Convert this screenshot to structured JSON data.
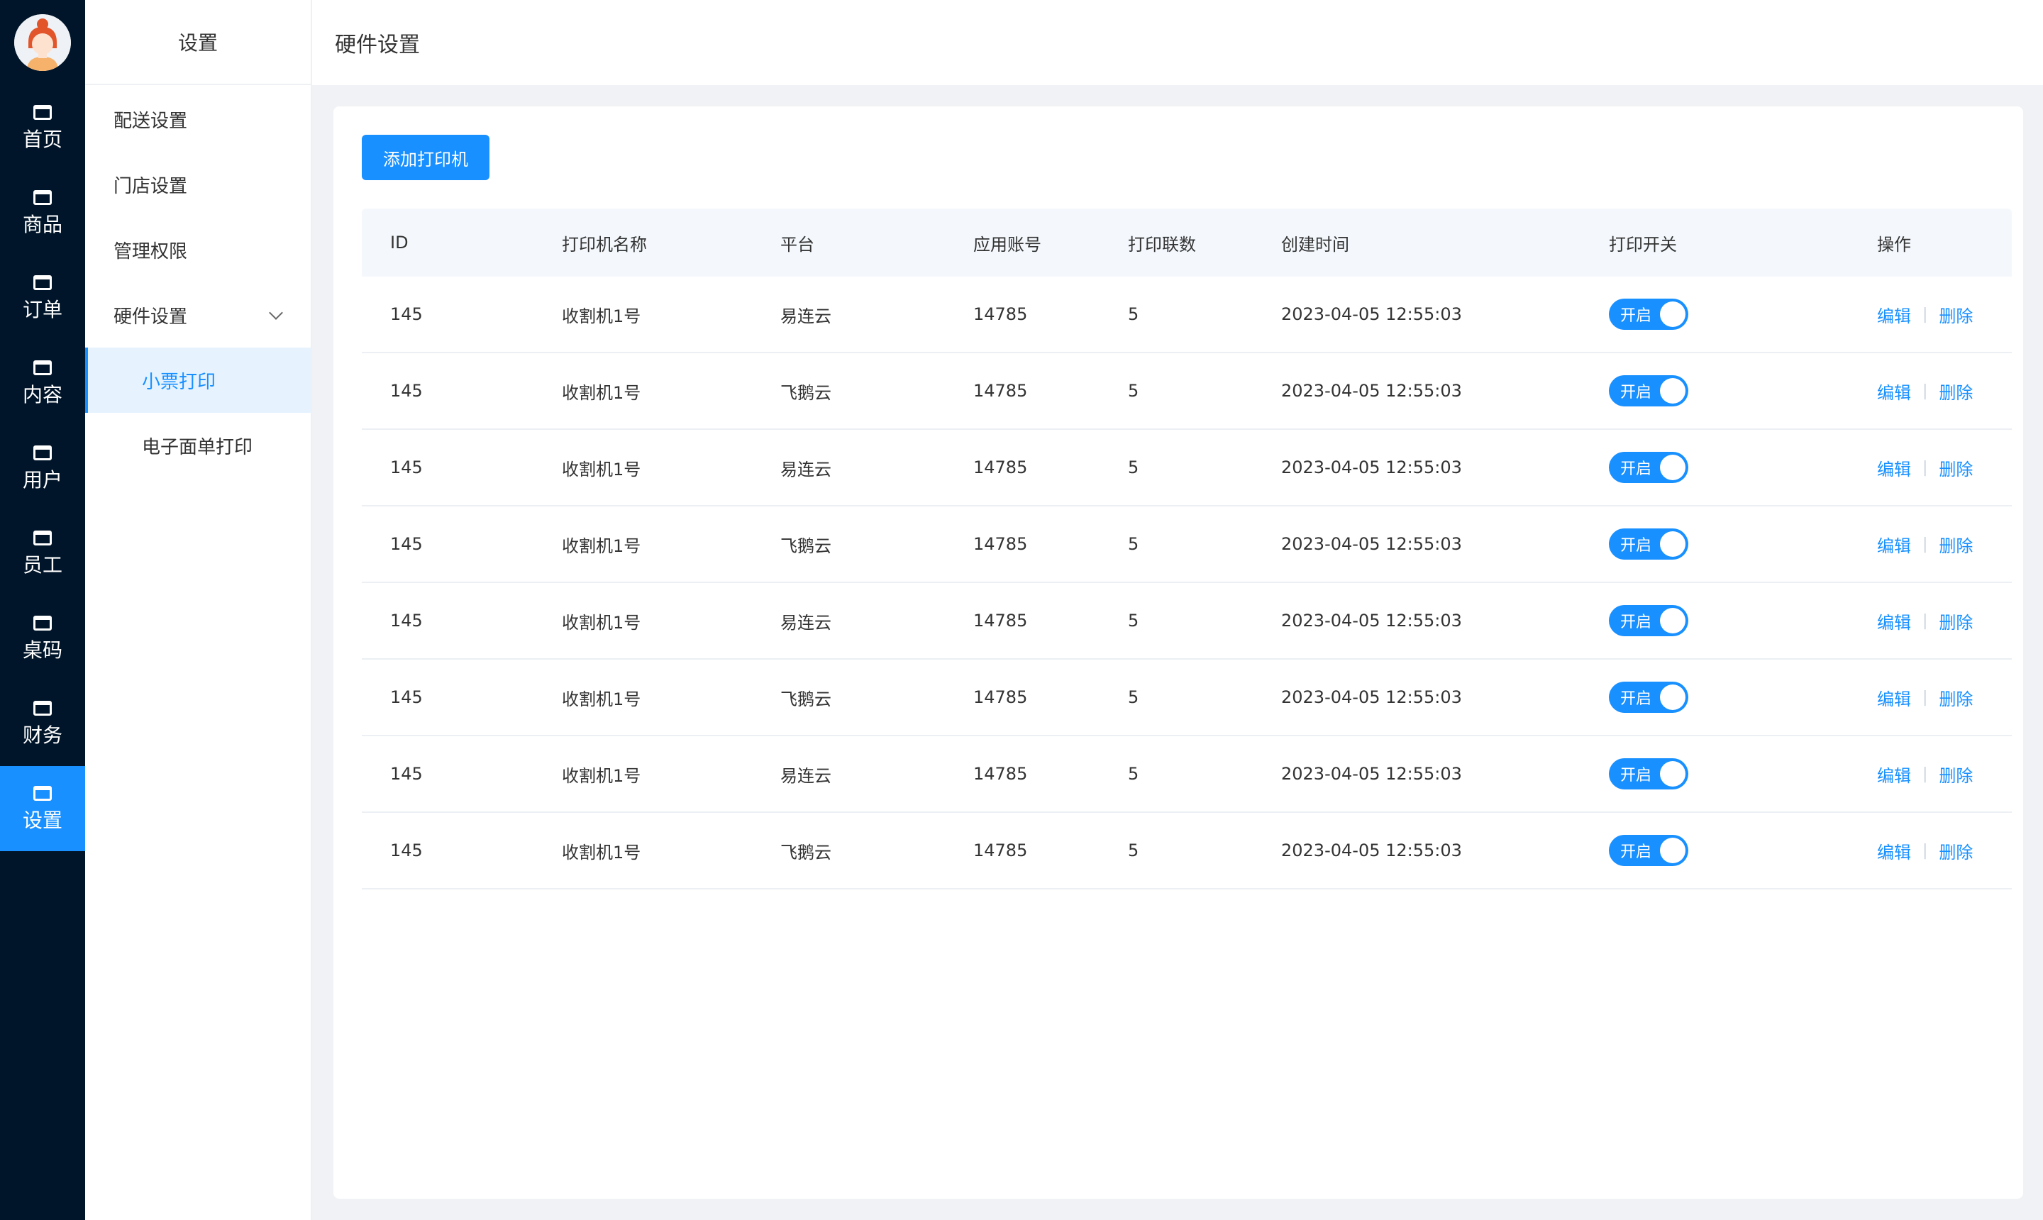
{
  "nav": {
    "items": [
      {
        "label": "首页",
        "icon": "window-icon"
      },
      {
        "label": "商品",
        "icon": "window-icon"
      },
      {
        "label": "订单",
        "icon": "window-icon"
      },
      {
        "label": "内容",
        "icon": "window-icon"
      },
      {
        "label": "用户",
        "icon": "window-icon"
      },
      {
        "label": "员工",
        "icon": "window-icon"
      },
      {
        "label": "桌码",
        "icon": "window-icon"
      },
      {
        "label": "财务",
        "icon": "window-icon"
      },
      {
        "label": "设置",
        "icon": "window-icon",
        "active": true
      }
    ]
  },
  "submenu": {
    "title": "设置",
    "items": [
      {
        "label": "配送设置"
      },
      {
        "label": "门店设置"
      },
      {
        "label": "管理权限"
      },
      {
        "label": "硬件设置",
        "expanded": true
      },
      {
        "label": "小票打印",
        "active": true
      },
      {
        "label": "电子面单打印"
      }
    ]
  },
  "header": {
    "title": "硬件设置"
  },
  "toolbar": {
    "add_label": "添加打印机"
  },
  "table": {
    "columns": [
      "ID",
      "打印机名称",
      "平台",
      "应用账号",
      "打印联数",
      "创建时间",
      "打印开关",
      "操作"
    ],
    "rows": [
      {
        "id": "145",
        "name": "收割机1号",
        "platform": "易连云",
        "account": "14785",
        "copies": "5",
        "created": "2023-04-05 12:55:03",
        "switch": "开启",
        "edit": "编辑",
        "delete": "删除"
      },
      {
        "id": "145",
        "name": "收割机1号",
        "platform": "飞鹅云",
        "account": "14785",
        "copies": "5",
        "created": "2023-04-05 12:55:03",
        "switch": "开启",
        "edit": "编辑",
        "delete": "删除"
      },
      {
        "id": "145",
        "name": "收割机1号",
        "platform": "易连云",
        "account": "14785",
        "copies": "5",
        "created": "2023-04-05 12:55:03",
        "switch": "开启",
        "edit": "编辑",
        "delete": "删除"
      },
      {
        "id": "145",
        "name": "收割机1号",
        "platform": "飞鹅云",
        "account": "14785",
        "copies": "5",
        "created": "2023-04-05 12:55:03",
        "switch": "开启",
        "edit": "编辑",
        "delete": "删除"
      },
      {
        "id": "145",
        "name": "收割机1号",
        "platform": "易连云",
        "account": "14785",
        "copies": "5",
        "created": "2023-04-05 12:55:03",
        "switch": "开启",
        "edit": "编辑",
        "delete": "删除"
      },
      {
        "id": "145",
        "name": "收割机1号",
        "platform": "飞鹅云",
        "account": "14785",
        "copies": "5",
        "created": "2023-04-05 12:55:03",
        "switch": "开启",
        "edit": "编辑",
        "delete": "删除"
      },
      {
        "id": "145",
        "name": "收割机1号",
        "platform": "易连云",
        "account": "14785",
        "copies": "5",
        "created": "2023-04-05 12:55:03",
        "switch": "开启",
        "edit": "编辑",
        "delete": "删除"
      },
      {
        "id": "145",
        "name": "收割机1号",
        "platform": "飞鹅云",
        "account": "14785",
        "copies": "5",
        "created": "2023-04-05 12:55:03",
        "switch": "开启",
        "edit": "编辑",
        "delete": "删除"
      }
    ]
  },
  "colors": {
    "primary": "#1890ff",
    "rail": "#001529",
    "page_bg": "#f0f2f5"
  }
}
